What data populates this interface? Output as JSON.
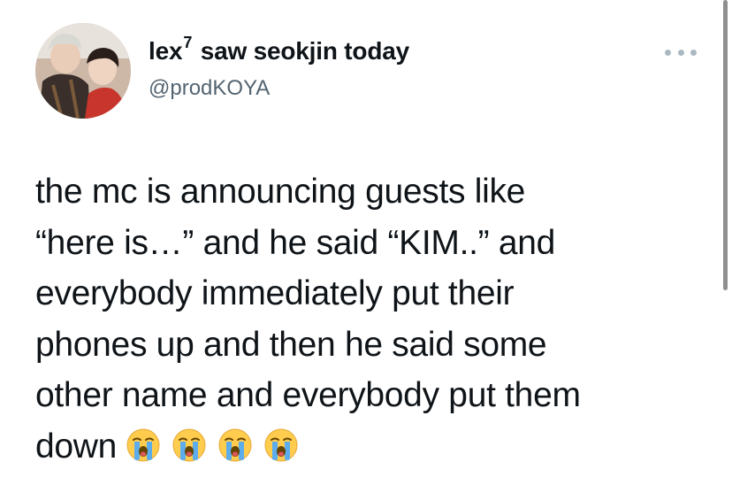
{
  "tweet": {
    "display_name": "lex",
    "display_name_sup": "7",
    "display_name_rest": "saw seokjin today",
    "handle": "@prodKOYA",
    "body_lines": [
      "the mc is announcing guests like",
      "“here is…” and he said “KIM..” and",
      "everybody immediately put their",
      "phones up and then he said some",
      "other name and everybody put them",
      "down"
    ],
    "emojis": [
      "loudly-crying-face",
      "loudly-crying-face",
      "loudly-crying-face",
      "loudly-crying-face"
    ]
  },
  "colors": {
    "text": "#0f1419",
    "secondary": "#536471",
    "more_dots": "#aab8c2",
    "background": "#ffffff"
  },
  "icons": {
    "more": "more-horizontal-icon",
    "avatar": "profile-avatar"
  }
}
